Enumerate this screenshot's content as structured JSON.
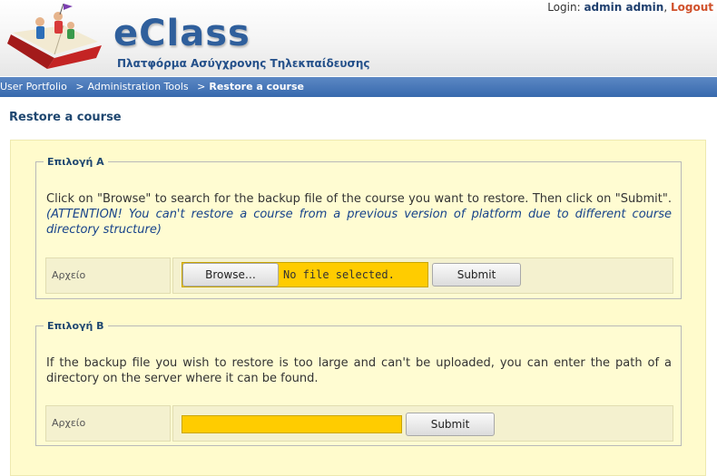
{
  "header": {
    "brand": "eClass",
    "tagline": "Πλατφόρμα Ασύγχρονης Τηλεκπαίδευσης",
    "login_label": "Login:",
    "user_name": "admin admin",
    "logout_label": "Logout"
  },
  "breadcrumb": {
    "items": [
      "User Portfolio",
      "Administration Tools"
    ],
    "current": "Restore a course",
    "separator": ">"
  },
  "page_title": "Restore a course",
  "option_a": {
    "legend": "Επιλογή A",
    "instructions": "Click on \"Browse\" to search for the backup file of the course you want to restore. Then click on \"Submit\".",
    "warning": "(ATTENTION! You can't restore a course from a previous version of platform due to different course directory structure)",
    "field_label": "Αρχείο",
    "browse_label": "Browse…",
    "file_status": "No file selected.",
    "submit_label": "Submit"
  },
  "option_b": {
    "legend": "Επιλογή B",
    "instructions": "If the backup file you wish to restore is too large and can't be uploaded, you can enter the path of a directory on the server where it can be found.",
    "field_label": "Αρχείο",
    "path_value": "",
    "submit_label": "Submit"
  },
  "colors": {
    "breadcrumb_bar": "#3769ad",
    "panel_background": "#fffbcc",
    "input_highlight": "#ffcc00",
    "brand_blue": "#2f5f9c",
    "logout": "#d0502a"
  }
}
